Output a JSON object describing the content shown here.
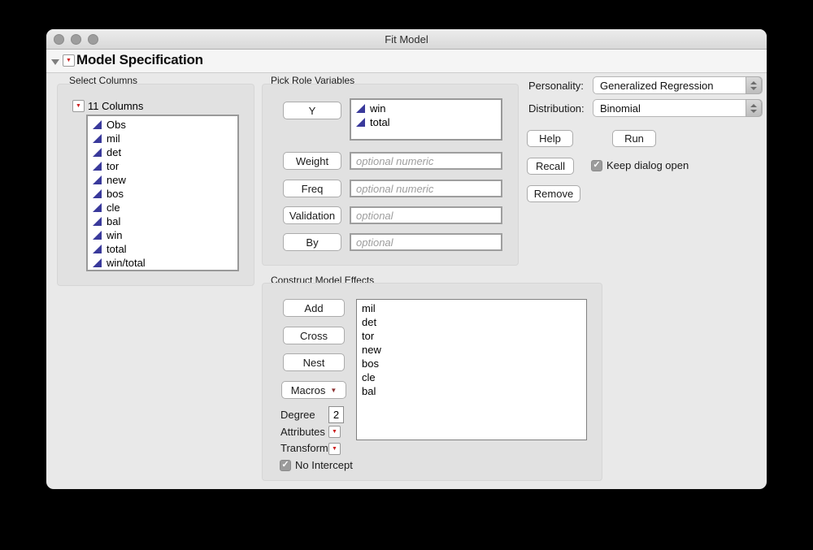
{
  "window": {
    "title": "Fit Model"
  },
  "header": {
    "title": "Model Specification"
  },
  "select_columns": {
    "label": "Select Columns",
    "columns_header": "11 Columns",
    "items": [
      "Obs",
      "mil",
      "det",
      "tor",
      "new",
      "bos",
      "cle",
      "bal",
      "win",
      "total",
      "win/total"
    ]
  },
  "pick_roles": {
    "label": "Pick Role Variables",
    "y_button": "Y",
    "y_items": [
      "win",
      "total"
    ],
    "rows": [
      {
        "button": "Weight",
        "placeholder": "optional numeric"
      },
      {
        "button": "Freq",
        "placeholder": "optional numeric"
      },
      {
        "button": "Validation",
        "placeholder": "optional"
      },
      {
        "button": "By",
        "placeholder": "optional"
      }
    ]
  },
  "personality": {
    "label": "Personality:",
    "value": "Generalized Regression"
  },
  "distribution": {
    "label": "Distribution:",
    "value": "Binomial"
  },
  "actions": {
    "help": "Help",
    "run": "Run",
    "recall": "Recall",
    "remove": "Remove",
    "keep_dialog_label": "Keep dialog open",
    "keep_dialog_check": "✓"
  },
  "effects": {
    "label": "Construct Model Effects",
    "add": "Add",
    "cross": "Cross",
    "nest": "Nest",
    "macros": "Macros",
    "degree_label": "Degree",
    "degree_value": "2",
    "attributes_label": "Attributes",
    "transform_label": "Transform",
    "no_intercept_label": "No Intercept",
    "no_intercept_check": "✓",
    "items": [
      "mil",
      "det",
      "tor",
      "new",
      "bos",
      "cle",
      "bal"
    ]
  },
  "icons": {
    "red_triangle": "▼"
  },
  "colors": {
    "continuous_icon": "#39399b",
    "red_triangle": "#ce1f1f",
    "macros_arrow": "#8c3232"
  }
}
